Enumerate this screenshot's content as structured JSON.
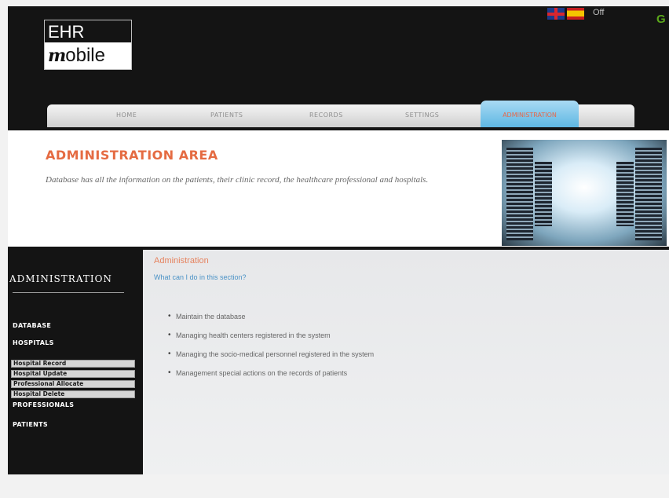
{
  "logo": {
    "line1": "EHR",
    "line2_mark": "m",
    "line2_text": "obile"
  },
  "language": {
    "flags": [
      "uk-flag-icon",
      "spain-flag-icon"
    ],
    "status": "Off",
    "extra": "G"
  },
  "nav": {
    "items": [
      "HOME",
      "PATIENTS",
      "RECORDS",
      "SETTINGS"
    ],
    "active": "ADMINISTRATION"
  },
  "banner": {
    "title": "ADMINISTRATION AREA",
    "description": "Database has all the information on the patients, their clinic record, the healthcare professional and hospitals."
  },
  "sidebar": {
    "title": "ADMINISTRATION",
    "categories": [
      "DATABASE",
      "HOSPITALS",
      "PROFESSIONALS",
      "PATIENTS"
    ],
    "hospital_actions": [
      "Hospital Record",
      "Hospital Update",
      "Professional Allocate",
      "Hospital Delete"
    ]
  },
  "content": {
    "title": "Administration",
    "question": "What can I do in this section?",
    "items": [
      "Maintain the database",
      "Managing health centers registered in the system",
      "Managing the socio-medical personnel registered in the system",
      "Management special actions on the records of patients"
    ]
  },
  "colors": {
    "accent": "#e56b42",
    "active_tab": "#5eb7e3",
    "link": "#4a92c6",
    "header_bg": "#141414"
  }
}
